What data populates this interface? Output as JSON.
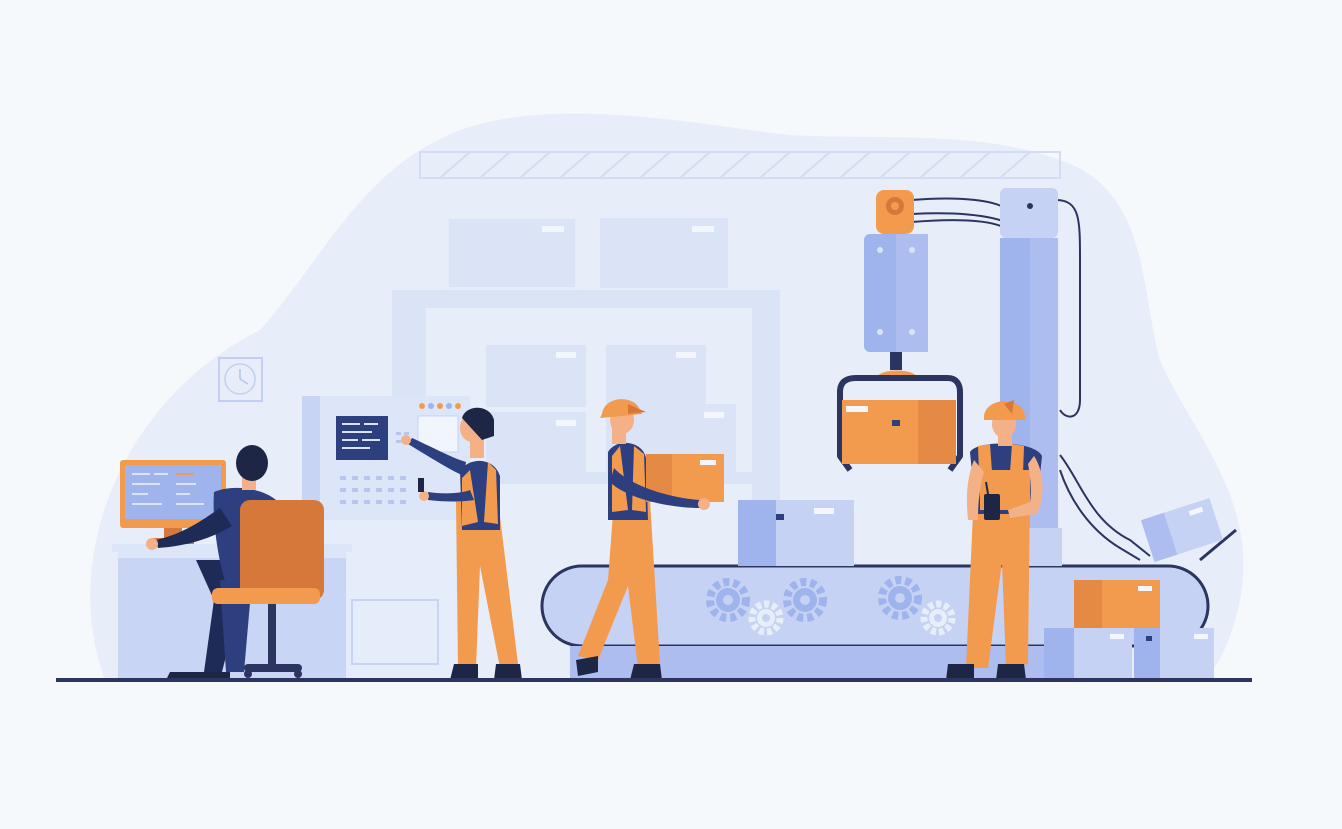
{
  "illustration": {
    "subject": "factory-production-line",
    "colors": {
      "background": "#f6f9fc",
      "blob": "#e8eef9",
      "pale_blue": "#dbe4f7",
      "light_blue": "#c5d2f3",
      "mid_blue": "#9fb3ec",
      "periwinkle": "#aebdf0",
      "navy": "#2e3f80",
      "dark_navy": "#1f2b57",
      "orange": "#f29b4f",
      "dark_orange": "#d6783a",
      "skin": "#f4b188",
      "hair": "#1d2745",
      "floor_line": "#2b3560"
    }
  }
}
